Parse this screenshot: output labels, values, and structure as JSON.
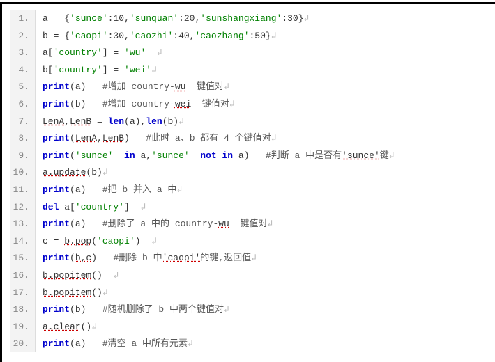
{
  "lines": [
    {
      "n": "1.",
      "tokens": [
        [
          "",
          "a = {"
        ],
        [
          "str",
          "'sunce'"
        ],
        [
          "",
          ":10,"
        ],
        [
          "str",
          "'sunquan'"
        ],
        [
          "",
          ":20,"
        ],
        [
          "str",
          "'sunshangxiang'"
        ],
        [
          "",
          ":30}"
        ],
        [
          "ret",
          "↲"
        ]
      ]
    },
    {
      "n": "2.",
      "tokens": [
        [
          "",
          "b = {"
        ],
        [
          "str",
          "'caopi'"
        ],
        [
          "",
          ":30,"
        ],
        [
          "str",
          "'caozhi'"
        ],
        [
          "",
          ":40,"
        ],
        [
          "str",
          "'caozhang'"
        ],
        [
          "",
          ":50}"
        ],
        [
          "ret",
          "↲"
        ]
      ]
    },
    {
      "n": "3.",
      "tokens": [
        [
          "",
          "a["
        ],
        [
          "str",
          "'country'"
        ],
        [
          "",
          "] = "
        ],
        [
          "str",
          "'wu'"
        ],
        [
          "",
          "  "
        ],
        [
          "ret",
          "↲"
        ]
      ]
    },
    {
      "n": "4.",
      "tokens": [
        [
          "",
          "b["
        ],
        [
          "str",
          "'country'"
        ],
        [
          "",
          "] = "
        ],
        [
          "str",
          "'wei'"
        ],
        [
          "ret",
          "↲"
        ]
      ]
    },
    {
      "n": "5.",
      "tokens": [
        [
          "kw",
          "print"
        ],
        [
          "",
          "(a)   "
        ],
        [
          "cm",
          "#增加 country-"
        ],
        [
          "nm",
          "wu"
        ],
        [
          "cm",
          "  键值对"
        ],
        [
          "ret",
          "↲"
        ]
      ]
    },
    {
      "n": "6.",
      "tokens": [
        [
          "kw",
          "print"
        ],
        [
          "",
          "(b)   "
        ],
        [
          "cm",
          "#增加 country-"
        ],
        [
          "nm",
          "wei"
        ],
        [
          "cm",
          "  键值对"
        ],
        [
          "ret",
          "↲"
        ]
      ]
    },
    {
      "n": "7.",
      "tokens": [
        [
          "nm",
          "LenA"
        ],
        [
          "",
          ","
        ],
        [
          "nm",
          "LenB"
        ],
        [
          "",
          ""
        ],
        [
          "",
          ""
        ],
        [
          "",
          ""
        ],
        [
          "",
          ""
        ],
        [
          "",
          ""
        ],
        [
          "",
          ""
        ],
        [
          "",
          ""
        ],
        [
          "",
          ""
        ],
        [
          "",
          ""
        ],
        [
          "",
          ""
        ],
        [
          "",
          ""
        ],
        [
          "",
          ""
        ],
        [
          "",
          ""
        ],
        [
          "",
          ""
        ],
        [
          "",
          ""
        ],
        [
          "",
          ""
        ],
        [
          "",
          ""
        ],
        [
          "",
          ""
        ],
        [
          "",
          ""
        ],
        [
          "",
          ""
        ],
        [
          "",
          ""
        ],
        [
          "",
          ""
        ],
        [
          "",
          ""
        ],
        [
          "",
          ""
        ],
        [
          "",
          ""
        ],
        [
          "",
          ""
        ],
        [
          "",
          ""
        ],
        [
          "",
          ""
        ],
        [
          "",
          ""
        ],
        [
          "",
          ""
        ],
        [
          "",
          ""
        ],
        [
          "",
          ""
        ],
        [
          "",
          ""
        ]
      ]
    },
    {
      "n": "7.",
      "tokens": [
        [
          "nm",
          "LenA"
        ],
        [
          "",
          ","
        ],
        [
          "nm",
          "LenB"
        ],
        [
          "",
          ""
        ],
        [
          "",
          ""
        ],
        [
          "",
          ""
        ],
        [
          "",
          ""
        ],
        [
          "",
          ""
        ],
        [
          "",
          ""
        ],
        [
          "",
          ""
        ],
        [
          "",
          ""
        ],
        [
          "",
          ""
        ],
        [
          "",
          ""
        ],
        [
          "",
          ""
        ],
        [
          "",
          ""
        ],
        [
          "",
          ""
        ],
        [
          "",
          ""
        ],
        [
          "",
          ""
        ],
        [
          "",
          ""
        ],
        [
          "",
          ""
        ],
        [
          "",
          ""
        ],
        [
          "",
          ""
        ],
        [
          "",
          ""
        ],
        [
          "",
          ""
        ],
        [
          "",
          ""
        ],
        [
          "",
          ""
        ],
        [
          "",
          ""
        ],
        [
          "",
          ""
        ],
        [
          "",
          ""
        ],
        [
          "",
          ""
        ],
        [
          "",
          ""
        ],
        [
          "",
          ""
        ],
        [
          "",
          ""
        ],
        [
          "",
          ""
        ],
        [
          "",
          ""
        ],
        [
          "",
          ""
        ]
      ]
    }
  ],
  "code_lines": [
    {
      "n": "1.",
      "seg": [
        [
          "p",
          "a = {"
        ],
        [
          "s",
          "'sunce'"
        ],
        [
          "p",
          ":10,"
        ],
        [
          "s",
          "'sunquan'"
        ],
        [
          "p",
          ":20,"
        ],
        [
          "s",
          "'sunshangxiang'"
        ],
        [
          "p",
          ":30}"
        ],
        [
          "r",
          "↲"
        ]
      ]
    },
    {
      "n": "2.",
      "seg": [
        [
          "p",
          "b = {"
        ],
        [
          "s",
          "'caopi'"
        ],
        [
          "p",
          ":30,"
        ],
        [
          "s",
          "'caozhi'"
        ],
        [
          "p",
          ":40,"
        ],
        [
          "s",
          "'caozhang'"
        ],
        [
          "p",
          ":50}"
        ],
        [
          "r",
          "↲"
        ]
      ]
    },
    {
      "n": "3.",
      "seg": [
        [
          "p",
          "a["
        ],
        [
          "s",
          "'country'"
        ],
        [
          "p",
          "] = "
        ],
        [
          "s",
          "'wu'"
        ],
        [
          "p",
          "  "
        ],
        [
          "r",
          "↲"
        ]
      ]
    },
    {
      "n": "4.",
      "seg": [
        [
          "p",
          "b["
        ],
        [
          "s",
          "'country'"
        ],
        [
          "p",
          "] = "
        ],
        [
          "s",
          "'wei'"
        ],
        [
          "r",
          "↲"
        ]
      ]
    },
    {
      "n": "5.",
      "seg": [
        [
          "k",
          "print"
        ],
        [
          "p",
          "(a)   "
        ],
        [
          "c",
          "#增加 country-"
        ],
        [
          "u",
          "wu"
        ],
        [
          "c",
          "  键值对"
        ],
        [
          "r",
          "↲"
        ]
      ]
    },
    {
      "n": "6.",
      "seg": [
        [
          "k",
          "print"
        ],
        [
          "p",
          "(b)   "
        ],
        [
          "c",
          "#增加 country-"
        ],
        [
          "u",
          "wei"
        ],
        [
          "c",
          "  键值对"
        ],
        [
          "r",
          "↲"
        ]
      ]
    },
    {
      "n": "7.",
      "seg": [
        [
          "u",
          "LenA"
        ],
        [
          "p",
          ","
        ],
        [
          "u",
          "LenB"
        ],
        [
          "p",
          " = "
        ],
        [
          "k",
          "len"
        ],
        [
          "p",
          "(a),"
        ],
        [
          "k",
          "len"
        ],
        [
          "p",
          "(b)"
        ],
        [
          "r",
          "↲"
        ]
      ]
    },
    {
      "n": "8.",
      "seg": [
        [
          "k",
          "print"
        ],
        [
          "p",
          "("
        ],
        [
          "u",
          "LenA"
        ],
        [
          "p",
          ","
        ],
        [
          "u",
          "LenB"
        ],
        [
          "p",
          ")   "
        ],
        [
          "c",
          "#此时 a、b 都有 4 个键值对"
        ],
        [
          "r",
          "↲"
        ]
      ]
    },
    {
      "n": "9.",
      "seg": [
        [
          "k",
          "print"
        ],
        [
          "p",
          "("
        ],
        [
          "s",
          "'sunce'"
        ],
        [
          "p",
          "  "
        ],
        [
          "k",
          "in"
        ],
        [
          "p",
          " a,"
        ],
        [
          "s",
          "'sunce'"
        ],
        [
          "p",
          "  "
        ],
        [
          "k",
          "not"
        ],
        [
          "p",
          " "
        ],
        [
          "k",
          "in"
        ],
        [
          "p",
          " a)   "
        ],
        [
          "c",
          "#判断 a 中是否有"
        ],
        [
          "u",
          "'sunce'"
        ],
        [
          "c",
          "键"
        ],
        [
          "r",
          "↲"
        ]
      ]
    },
    {
      "n": "10.",
      "seg": [
        [
          "u",
          "a.update"
        ],
        [
          "p",
          "(b)"
        ],
        [
          "r",
          "↲"
        ]
      ]
    },
    {
      "n": "11.",
      "seg": [
        [
          "k",
          "print"
        ],
        [
          "p",
          "(a)   "
        ],
        [
          "c",
          "#把 b 并入 a 中"
        ],
        [
          "r",
          "↲"
        ]
      ]
    },
    {
      "n": "12.",
      "seg": [
        [
          "k",
          "del"
        ],
        [
          "p",
          " a["
        ],
        [
          "s",
          "'country'"
        ],
        [
          "p",
          "]  "
        ],
        [
          "r",
          "↲"
        ]
      ]
    },
    {
      "n": "13.",
      "seg": [
        [
          "k",
          "print"
        ],
        [
          "p",
          "(a)   "
        ],
        [
          "c",
          "#删除了 a 中的 country-"
        ],
        [
          "u",
          "wu"
        ],
        [
          "c",
          "  键值对"
        ],
        [
          "r",
          "↲"
        ]
      ]
    },
    {
      "n": "14.",
      "seg": [
        [
          "p",
          "c = "
        ],
        [
          "u",
          "b.pop"
        ],
        [
          "p",
          "("
        ],
        [
          "s",
          "'caopi'"
        ],
        [
          "p",
          ")  "
        ],
        [
          "r",
          "↲"
        ]
      ]
    },
    {
      "n": "15.",
      "seg": [
        [
          "k",
          "print"
        ],
        [
          "p",
          "("
        ],
        [
          "u",
          "b,c"
        ],
        [
          "p",
          ")   "
        ],
        [
          "c",
          "#删除 b 中"
        ],
        [
          "u",
          "'caopi'"
        ],
        [
          "c",
          "的键,返回值"
        ],
        [
          "r",
          "↲"
        ]
      ]
    },
    {
      "n": "16.",
      "seg": [
        [
          "u",
          "b.popitem"
        ],
        [
          "p",
          "()  "
        ],
        [
          "r",
          "↲"
        ]
      ]
    },
    {
      "n": "17.",
      "seg": [
        [
          "u",
          "b.popitem"
        ],
        [
          "p",
          "()"
        ],
        [
          "r",
          "↲"
        ]
      ]
    },
    {
      "n": "18.",
      "seg": [
        [
          "k",
          "print"
        ],
        [
          "p",
          "(b)   "
        ],
        [
          "c",
          "#随机删除了 b 中两个键值对"
        ],
        [
          "r",
          "↲"
        ]
      ]
    },
    {
      "n": "19.",
      "seg": [
        [
          "u",
          "a.clear"
        ],
        [
          "p",
          "()"
        ],
        [
          "r",
          "↲"
        ]
      ]
    },
    {
      "n": "20.",
      "seg": [
        [
          "k",
          "print"
        ],
        [
          "p",
          "(a)   "
        ],
        [
          "c",
          "#清空 a 中所有元素"
        ],
        [
          "r",
          "↲"
        ]
      ]
    }
  ]
}
